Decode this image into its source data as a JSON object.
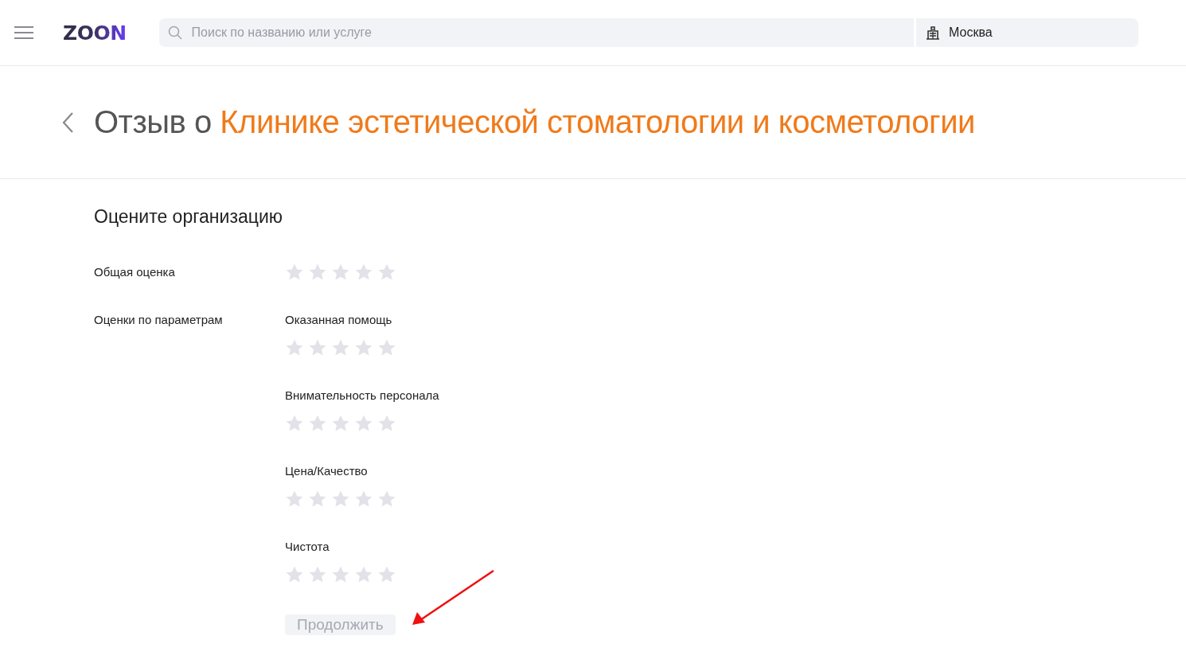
{
  "header": {
    "logo": "ZOON",
    "search": {
      "placeholder": "Поиск по названию или услуге"
    },
    "city": "Москва"
  },
  "title": {
    "prefix": "Отзыв о ",
    "organization": "Клинике эстетической стоматологии и косметологии"
  },
  "form": {
    "heading": "Оцените организацию",
    "overall": {
      "label": "Общая оценка",
      "stars": 0
    },
    "params_label": "Оценки по параметрам",
    "params": [
      {
        "label": "Оказанная помощь",
        "stars": 0
      },
      {
        "label": "Внимательность персонала",
        "stars": 0
      },
      {
        "label": "Цена/Качество",
        "stars": 0
      },
      {
        "label": "Чистота",
        "stars": 0
      }
    ],
    "submit": {
      "label": "Продолжить",
      "disabled": true
    }
  }
}
